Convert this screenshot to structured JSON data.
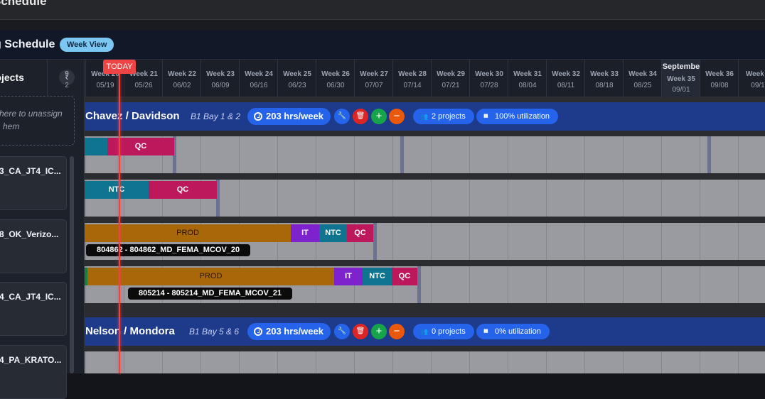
{
  "app": {
    "title": "Schedule"
  },
  "header": {
    "title": "g Schedule",
    "view_pill": "Week View"
  },
  "sidebar": {
    "heading": "rojects",
    "collapse_icon": "chevron-left-icon",
    "dropzone": {
      "line1": "here to unassign",
      "line2": "hem"
    },
    "cards": [
      "3_CA_JT4_IC...",
      "8_OK_Verizo...",
      "4_CA_JT4_IC...",
      "4_PA_KRATO..."
    ]
  },
  "timeline": {
    "today_label": "TODAY",
    "weeks": [
      {
        "week": "9",
        "date": "2",
        "month": ""
      },
      {
        "week": "Week 20",
        "date": "05/19",
        "month": ""
      },
      {
        "week": "Week 21",
        "date": "05/26",
        "month": ""
      },
      {
        "week": "Week 22",
        "date": "06/02",
        "month": ""
      },
      {
        "week": "Week 23",
        "date": "06/09",
        "month": ""
      },
      {
        "week": "Week 24",
        "date": "06/16",
        "month": ""
      },
      {
        "week": "Week 25",
        "date": "06/23",
        "month": ""
      },
      {
        "week": "Week 26",
        "date": "06/30",
        "month": ""
      },
      {
        "week": "Week 27",
        "date": "07/07",
        "month": ""
      },
      {
        "week": "Week 28",
        "date": "07/14",
        "month": ""
      },
      {
        "week": "Week 29",
        "date": "07/21",
        "month": ""
      },
      {
        "week": "Week 30",
        "date": "07/28",
        "month": ""
      },
      {
        "week": "Week 31",
        "date": "08/04",
        "month": ""
      },
      {
        "week": "Week 32",
        "date": "08/11",
        "month": ""
      },
      {
        "week": "Week 33",
        "date": "08/18",
        "month": ""
      },
      {
        "week": "Week 34",
        "date": "08/25",
        "month": ""
      },
      {
        "week": "Week 35",
        "date": "09/01",
        "month": "Septembe"
      },
      {
        "week": "Week 36",
        "date": "09/08",
        "month": ""
      },
      {
        "week": "Week 3",
        "date": "09/1",
        "month": ""
      }
    ]
  },
  "bays": [
    {
      "name": "Chavez / Davidson",
      "location": "B1 Bay 1 & 2",
      "hours": "203 hrs/week",
      "projects": "2 projects",
      "utilization": "100% utilization"
    },
    {
      "name": "Nelson / Mondora",
      "location": "B1 Bay 5 & 6",
      "hours": "203 hrs/week",
      "projects": "0 projects",
      "utilization": "0% utilization"
    }
  ],
  "rows": [
    {
      "bars": [
        {
          "label": "",
          "kind": "ntc"
        },
        {
          "label": "QC",
          "kind": "qc"
        }
      ]
    },
    {
      "bars": [
        {
          "label": "NTC",
          "kind": "ntc"
        },
        {
          "label": "QC",
          "kind": "qc"
        }
      ]
    },
    {
      "bars": [
        {
          "label": "PROD",
          "kind": "prod"
        },
        {
          "label": "IT",
          "kind": "it"
        },
        {
          "label": "NTC",
          "kind": "ntc"
        },
        {
          "label": "QC",
          "kind": "qc"
        }
      ],
      "tag": "804862 - 804862_MD_FEMA_MCOV_20"
    },
    {
      "bars": [
        {
          "label": "",
          "kind": "green"
        },
        {
          "label": "PROD",
          "kind": "prod"
        },
        {
          "label": "IT",
          "kind": "it"
        },
        {
          "label": "NTC",
          "kind": "ntc"
        },
        {
          "label": "QC",
          "kind": "qc"
        }
      ],
      "tag": "805214 - 805214_MD_FEMA_MCOV_21"
    }
  ],
  "icons": {
    "clock": "clock-icon",
    "wrench": "wrench-icon",
    "trash": "trash-icon",
    "add": "plus-circle-icon",
    "remove": "minus-circle-icon",
    "users": "users-icon",
    "chart": "bar-chart-icon"
  },
  "colors": {
    "bay_header": "#1e3a8a",
    "chip": "#2563eb",
    "today": "#ef4444",
    "prod": "#a8680a",
    "it": "#7e22ce",
    "ntc": "#0e7490",
    "qc": "#be185d",
    "green": "#15803d"
  }
}
